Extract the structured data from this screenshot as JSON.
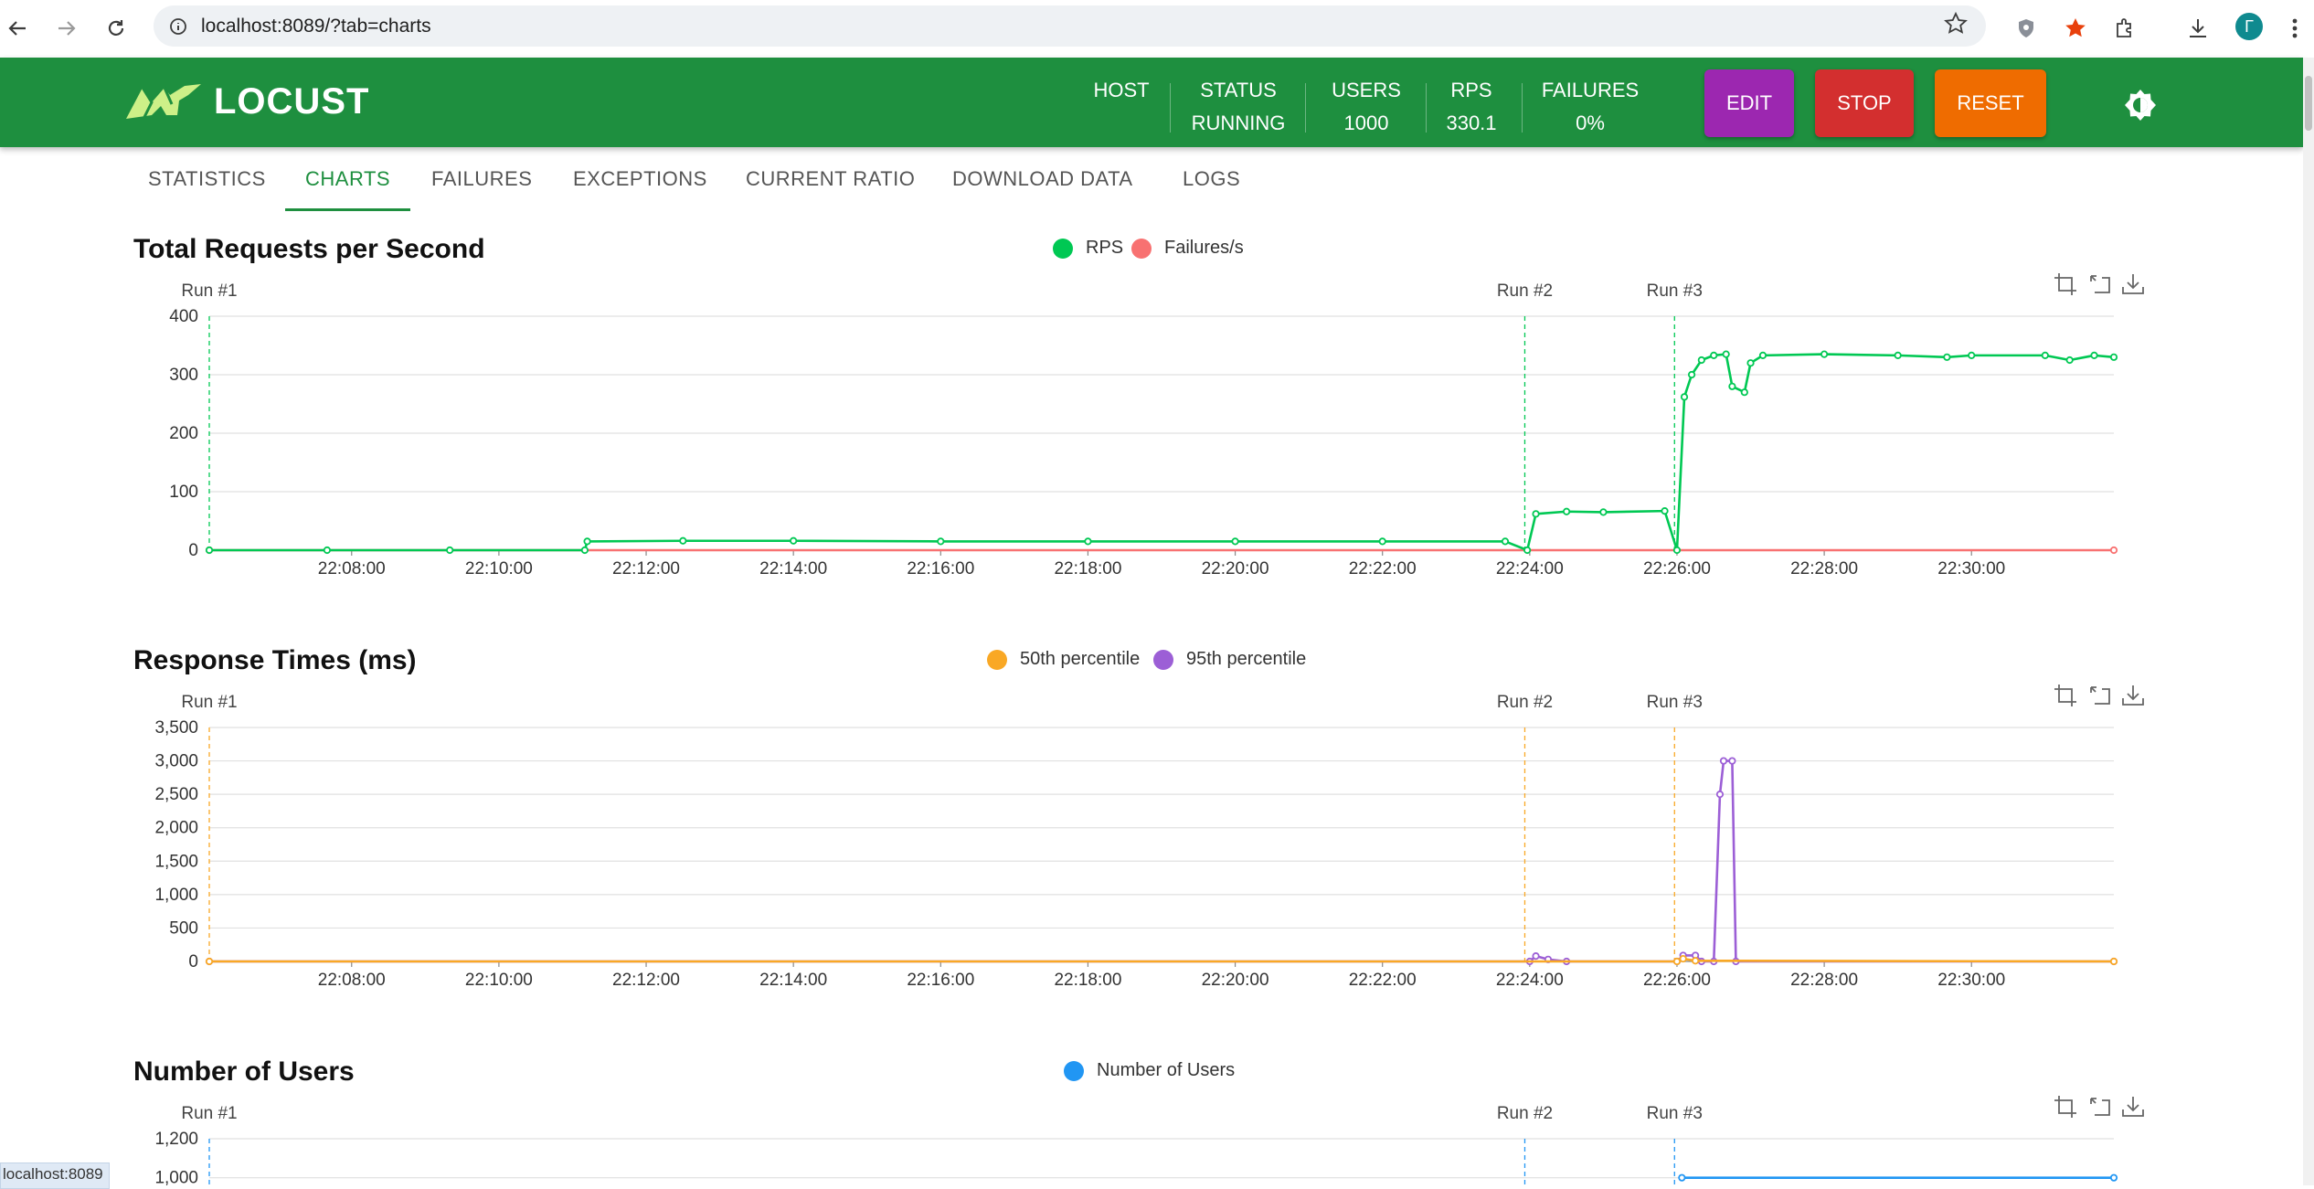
{
  "browser": {
    "url": "localhost:8089/?tab=charts",
    "profile_initial": "Г",
    "status_tip": "localhost:8089"
  },
  "header": {
    "logo_text": "LOCUST",
    "stats": [
      {
        "label": "HOST",
        "value": ""
      },
      {
        "label": "STATUS",
        "value": "RUNNING"
      },
      {
        "label": "USERS",
        "value": "1000"
      },
      {
        "label": "RPS",
        "value": "330.1"
      },
      {
        "label": "FAILURES",
        "value": "0%"
      }
    ],
    "buttons": {
      "edit": "EDIT",
      "stop": "STOP",
      "reset": "RESET"
    },
    "colors": {
      "header": "#1e8f3f",
      "edit": "#9c27b0",
      "stop": "#d32f2f",
      "reset": "#ef6c00"
    }
  },
  "tabs": [
    "STATISTICS",
    "CHARTS",
    "FAILURES",
    "EXCEPTIONS",
    "CURRENT RATIO",
    "DOWNLOAD DATA",
    "LOGS"
  ],
  "active_tab": "CHARTS",
  "chart_data": [
    {
      "type": "line",
      "title": "Total Requests per Second",
      "x_ticks": [
        "22:08:00",
        "22:10:00",
        "22:12:00",
        "22:14:00",
        "22:16:00",
        "22:18:00",
        "22:20:00",
        "22:22:00",
        "22:24:00",
        "22:26:00",
        "22:28:00",
        "22:30:00"
      ],
      "x_range": [
        "22:06:04",
        "22:31:56"
      ],
      "ylim": [
        0,
        400
      ],
      "y_ticks": [
        "0",
        "100",
        "200",
        "300",
        "400"
      ],
      "runs": [
        {
          "label": "Run #1",
          "time": "22:06:04"
        },
        {
          "label": "Run #2",
          "time": "22:23:56"
        },
        {
          "label": "Run #3",
          "time": "22:25:58"
        }
      ],
      "series": [
        {
          "name": "RPS",
          "color": "#00c853",
          "points": [
            [
              "22:06:04",
              0
            ],
            [
              "22:07:40",
              0
            ],
            [
              "22:09:20",
              0
            ],
            [
              "22:11:10",
              0
            ],
            [
              "22:11:12",
              15
            ],
            [
              "22:12:30",
              16
            ],
            [
              "22:14:00",
              16
            ],
            [
              "22:16:00",
              15
            ],
            [
              "22:18:00",
              15
            ],
            [
              "22:20:00",
              15
            ],
            [
              "22:22:00",
              15
            ],
            [
              "22:23:40",
              15
            ],
            [
              "22:23:58",
              0
            ],
            [
              "22:24:05",
              62
            ],
            [
              "22:24:30",
              66
            ],
            [
              "22:25:00",
              65
            ],
            [
              "22:25:50",
              67
            ],
            [
              "22:26:00",
              0
            ],
            [
              "22:26:06",
              262
            ],
            [
              "22:26:12",
              300
            ],
            [
              "22:26:20",
              325
            ],
            [
              "22:26:30",
              333
            ],
            [
              "22:26:40",
              335
            ],
            [
              "22:26:45",
              280
            ],
            [
              "22:26:55",
              270
            ],
            [
              "22:27:00",
              320
            ],
            [
              "22:27:10",
              333
            ],
            [
              "22:28:00",
              335
            ],
            [
              "22:29:00",
              333
            ],
            [
              "22:29:40",
              330
            ],
            [
              "22:30:00",
              333
            ],
            [
              "22:31:00",
              333
            ],
            [
              "22:31:20",
              325
            ],
            [
              "22:31:40",
              333
            ],
            [
              "22:31:56",
              330
            ]
          ]
        },
        {
          "name": "Failures/s",
          "color": "#f87171",
          "points": [
            [
              "22:06:04",
              0
            ],
            [
              "22:31:56",
              0
            ]
          ]
        }
      ]
    },
    {
      "type": "line",
      "title": "Response Times (ms)",
      "x_ticks": [
        "22:08:00",
        "22:10:00",
        "22:12:00",
        "22:14:00",
        "22:16:00",
        "22:18:00",
        "22:20:00",
        "22:22:00",
        "22:24:00",
        "22:26:00",
        "22:28:00",
        "22:30:00"
      ],
      "x_range": [
        "22:06:04",
        "22:31:56"
      ],
      "ylim": [
        0,
        3500
      ],
      "y_ticks": [
        "0",
        "500",
        "1,000",
        "1,500",
        "2,000",
        "2,500",
        "3,000",
        "3,500"
      ],
      "runs": [
        {
          "label": "Run #1",
          "time": "22:06:04"
        },
        {
          "label": "Run #2",
          "time": "22:23:56"
        },
        {
          "label": "Run #3",
          "time": "22:25:58"
        }
      ],
      "series": [
        {
          "name": "50th percentile",
          "color": "#f9a825",
          "points": [
            [
              "22:06:04",
              0
            ],
            [
              "22:26:00",
              0
            ],
            [
              "22:26:05",
              40
            ],
            [
              "22:26:15",
              10
            ],
            [
              "22:31:56",
              0
            ]
          ]
        },
        {
          "name": "95th percentile",
          "color": "#9c5fd6",
          "points": [
            [
              "22:06:04",
              0
            ],
            [
              "22:24:00",
              0
            ],
            [
              "22:24:05",
              80
            ],
            [
              "22:24:15",
              30
            ],
            [
              "22:24:30",
              0
            ],
            [
              "22:26:00",
              0
            ],
            [
              "22:26:05",
              90
            ],
            [
              "22:26:15",
              90
            ],
            [
              "22:26:20",
              0
            ],
            [
              "22:26:30",
              0
            ],
            [
              "22:26:35",
              2500
            ],
            [
              "22:26:38",
              3000
            ],
            [
              "22:26:45",
              3000
            ],
            [
              "22:26:48",
              0
            ],
            [
              "22:31:56",
              0
            ]
          ]
        }
      ]
    },
    {
      "type": "line",
      "title": "Number of Users",
      "x_range": [
        "22:06:04",
        "22:31:56"
      ],
      "ylim": [
        0,
        1200
      ],
      "y_ticks": [
        "1,000",
        "1,200"
      ],
      "runs": [
        {
          "label": "Run #1",
          "time": "22:06:04"
        },
        {
          "label": "Run #2",
          "time": "22:23:56"
        },
        {
          "label": "Run #3",
          "time": "22:25:58"
        }
      ],
      "series": [
        {
          "name": "Number of Users",
          "color": "#2196f3",
          "points": [
            [
              "22:26:04",
              1000
            ],
            [
              "22:31:56",
              1000
            ]
          ]
        }
      ]
    }
  ]
}
